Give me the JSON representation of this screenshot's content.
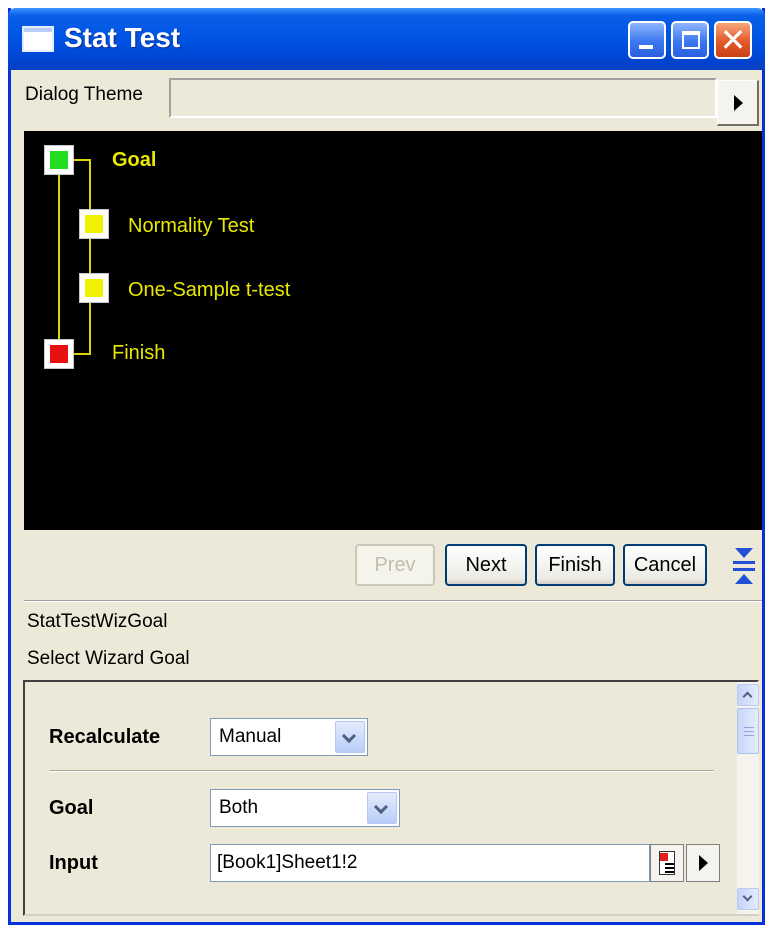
{
  "window": {
    "title": "Stat Test",
    "controls": {
      "minimize": "minimize",
      "maximize": "maximize",
      "close": "✕"
    }
  },
  "theme": {
    "label": "Dialog Theme",
    "value": ""
  },
  "wizard": {
    "steps": [
      {
        "label": "Goal",
        "status": "current",
        "color": "#22dd22"
      },
      {
        "label": "Normality Test",
        "status": "pending",
        "color": "#f0f000"
      },
      {
        "label": "One-Sample t-test",
        "status": "pending",
        "color": "#f0f000"
      },
      {
        "label": "Finish",
        "status": "end",
        "color": "#e81010"
      }
    ]
  },
  "nav": {
    "prev": "Prev",
    "next": "Next",
    "finish": "Finish",
    "cancel": "Cancel"
  },
  "info": {
    "name": "StatTestWizGoal",
    "description": "Select Wizard Goal"
  },
  "settings": {
    "recalculate": {
      "label": "Recalculate",
      "value": "Manual"
    },
    "goal": {
      "label": "Goal",
      "value": "Both"
    },
    "input": {
      "label": "Input",
      "value": "[Book1]Sheet1!2"
    }
  }
}
